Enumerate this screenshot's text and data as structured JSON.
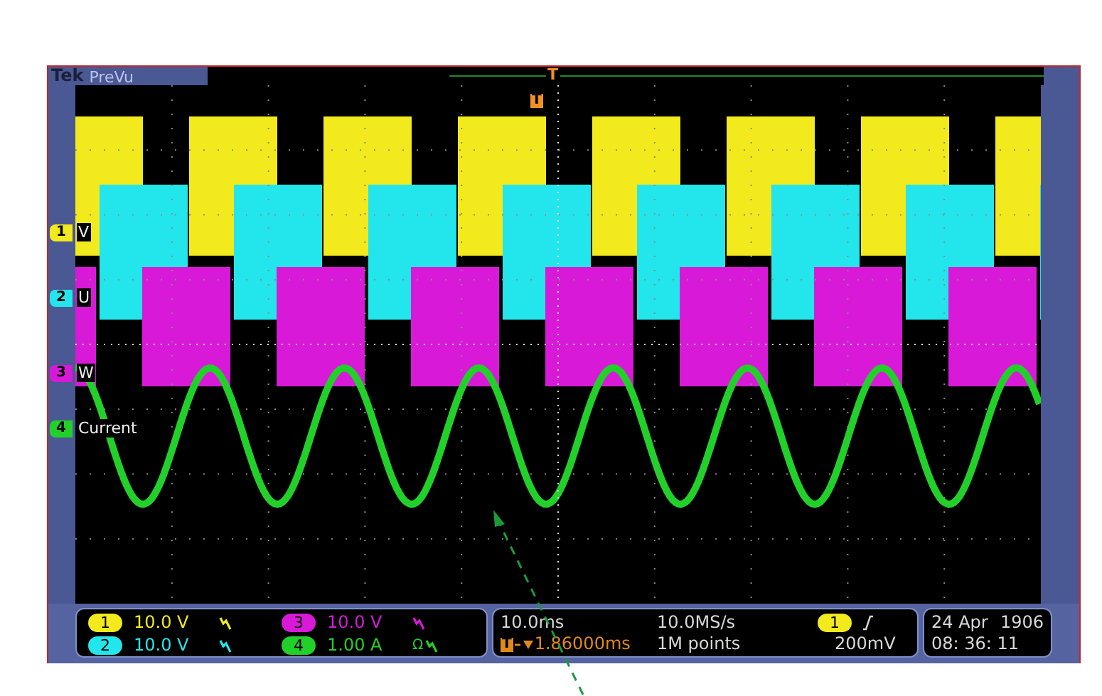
{
  "header": {
    "brand": "Tek",
    "mode": "PreVu"
  },
  "trigger_markers": [
    {
      "label": "T"
    },
    {
      "label": "T"
    }
  ],
  "channels": [
    {
      "marker": "1",
      "name": "V",
      "number": "1",
      "scale": "10.0 V",
      "color": "#f2ea1c",
      "kind": "square"
    },
    {
      "marker": "2",
      "name": "U",
      "number": "2",
      "scale": "10.0 V",
      "color": "#22e6ec",
      "kind": "square"
    },
    {
      "marker": "3",
      "name": "W",
      "number": "3",
      "scale": "10.0 V",
      "color": "#d81ad8",
      "kind": "square"
    },
    {
      "marker": "4",
      "name": "Current",
      "number": "4",
      "scale": "1.00 A",
      "termination": "Ω",
      "color": "#22d02a",
      "kind": "sine"
    }
  ],
  "horizontal": {
    "scale": "10.0ms",
    "delay_marker": "T",
    "delay": "1.86000ms",
    "sample_rate": "10.0MS/s",
    "record_length": "1M points"
  },
  "trigger": {
    "source": "1",
    "level": "200mV"
  },
  "clock": {
    "date": "24 Apr",
    "year": "1906",
    "time": "08: 36: 11"
  }
}
